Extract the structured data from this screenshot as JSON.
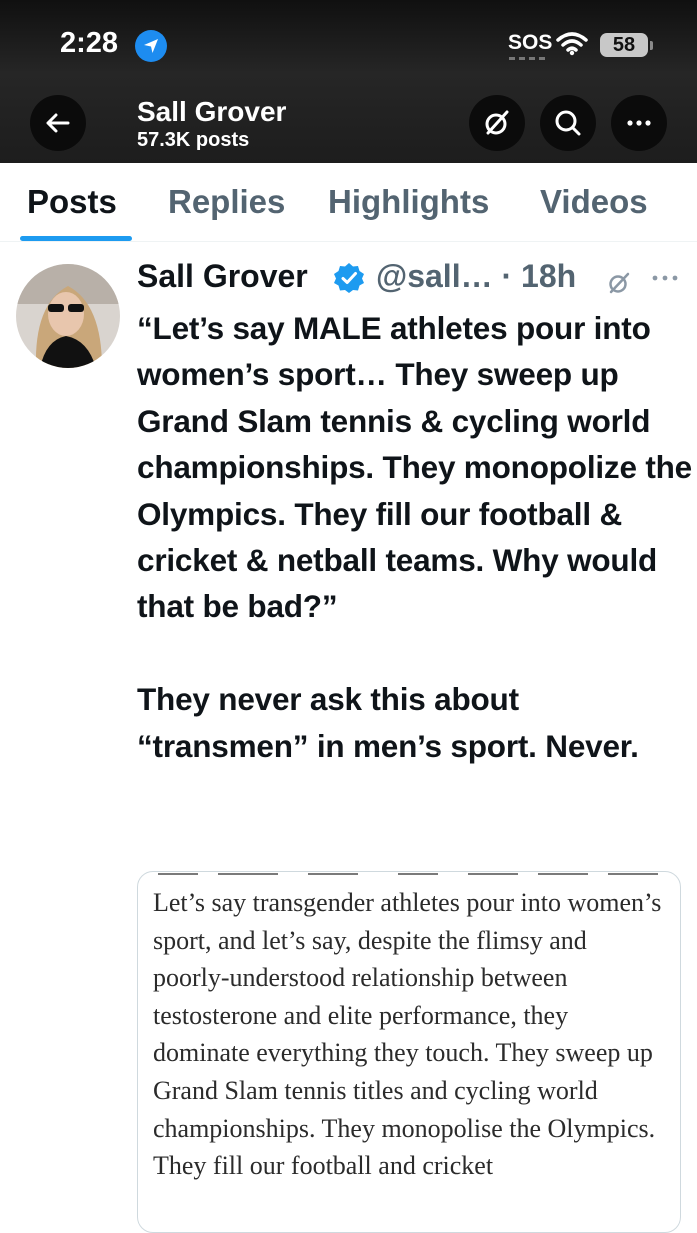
{
  "status_bar": {
    "time": "2:28",
    "sos": "SOS",
    "battery": "58"
  },
  "header": {
    "name": "Sall Grover",
    "posts": "57.3K posts"
  },
  "tabs": [
    {
      "label": "Posts",
      "active": true
    },
    {
      "label": "Replies",
      "active": false
    },
    {
      "label": "Highlights",
      "active": false
    },
    {
      "label": "Videos",
      "active": false
    }
  ],
  "tweet": {
    "author": "Sall Grover",
    "handle": "@sall… · 18h",
    "text": "“Let’s say MALE athletes pour into women’s sport… They sweep up Grand Slam tennis & cycling world championships. They monopolize the Olympics. They fill our football & cricket & netball teams. Why would that be bad?”\n\nThey never ask this about “transmen” in men’s sport. Never.",
    "quote_text": "Let’s say transgender athletes pour into women’s sport, and let’s say, despite the flimsy and poorly-understood relationship between testosterone and elite performance, they dominate everything they touch. They sweep up Grand Slam tennis titles and cycling world championships. They monopolise the Olympics. They fill our football and cricket"
  },
  "colors": {
    "accent": "#1d9bf0",
    "muted": "#536471",
    "text": "#0f1419"
  },
  "icons": [
    "location-arrow-icon",
    "wifi-icon",
    "back-arrow-icon",
    "grok-icon",
    "search-icon",
    "more-icon",
    "verified-badge-icon"
  ]
}
